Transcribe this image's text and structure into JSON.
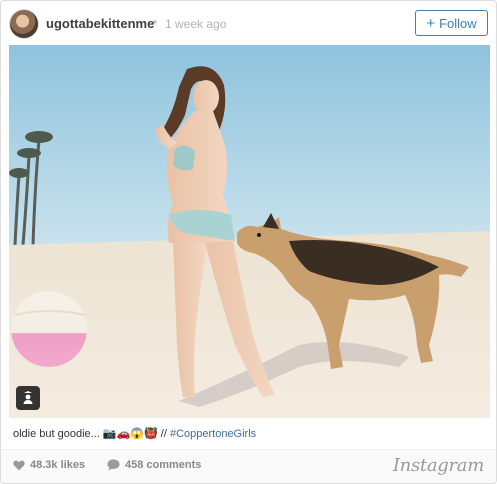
{
  "post": {
    "username": "ugottabekittenme",
    "separator": "•",
    "time_ago": "1 week ago",
    "follow_button": {
      "icon": "+",
      "label": "Follow"
    },
    "caption": {
      "text": "oldie but goodie...",
      "emoji": "📷🚗😱👹",
      "separator": " // ",
      "hashtag": "#CoppertoneGirls"
    },
    "stats": {
      "likes": "48.3k likes",
      "comments": "458 comments"
    },
    "brand": "Instagram"
  },
  "colors": {
    "accent": "#3f7fb4",
    "hashtag": "#3f6e97",
    "muted": "#888888"
  },
  "icons": {
    "likes": "heart-icon",
    "comments": "speech-bubble-icon",
    "user_tag": "user-tag-icon"
  }
}
